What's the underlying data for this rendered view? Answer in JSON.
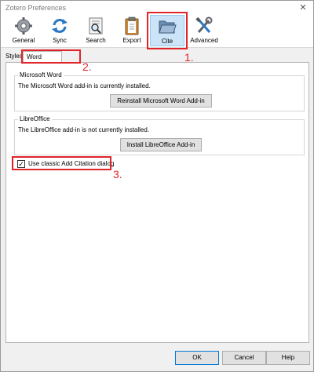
{
  "window": {
    "title": "Zotero Preferences"
  },
  "toolbar": {
    "items": [
      {
        "label": "General",
        "icon": "gear-icon"
      },
      {
        "label": "Sync",
        "icon": "sync-icon"
      },
      {
        "label": "Search",
        "icon": "search-icon"
      },
      {
        "label": "Export",
        "icon": "clipboard-icon"
      },
      {
        "label": "Cite",
        "icon": "folder-icon",
        "selected": true
      },
      {
        "label": "Advanced",
        "icon": "tools-icon"
      }
    ]
  },
  "tabs": [
    {
      "label": "Styles"
    },
    {
      "label": "Word Processors",
      "active": true
    }
  ],
  "word": {
    "legend": "Microsoft Word",
    "status": "The Microsoft Word add-in is currently installed.",
    "button": "Reinstall Microsoft Word Add-in"
  },
  "libreoffice": {
    "legend": "LibreOffice",
    "status": "The LibreOffice add-in is not currently installed.",
    "button": "Install LibreOffice Add-in"
  },
  "classic": {
    "label": "Use classic Add Citation dialog",
    "checked": true,
    "check_glyph": "✓"
  },
  "annotations": {
    "one": "1.",
    "two": "2.",
    "three": "3."
  },
  "dialog": {
    "ok": "OK",
    "cancel": "Cancel",
    "help": "Help"
  },
  "colors": {
    "annotation": "#e0242a",
    "selected_bg": "#cce4f7",
    "selected_border": "#99c9ef"
  }
}
